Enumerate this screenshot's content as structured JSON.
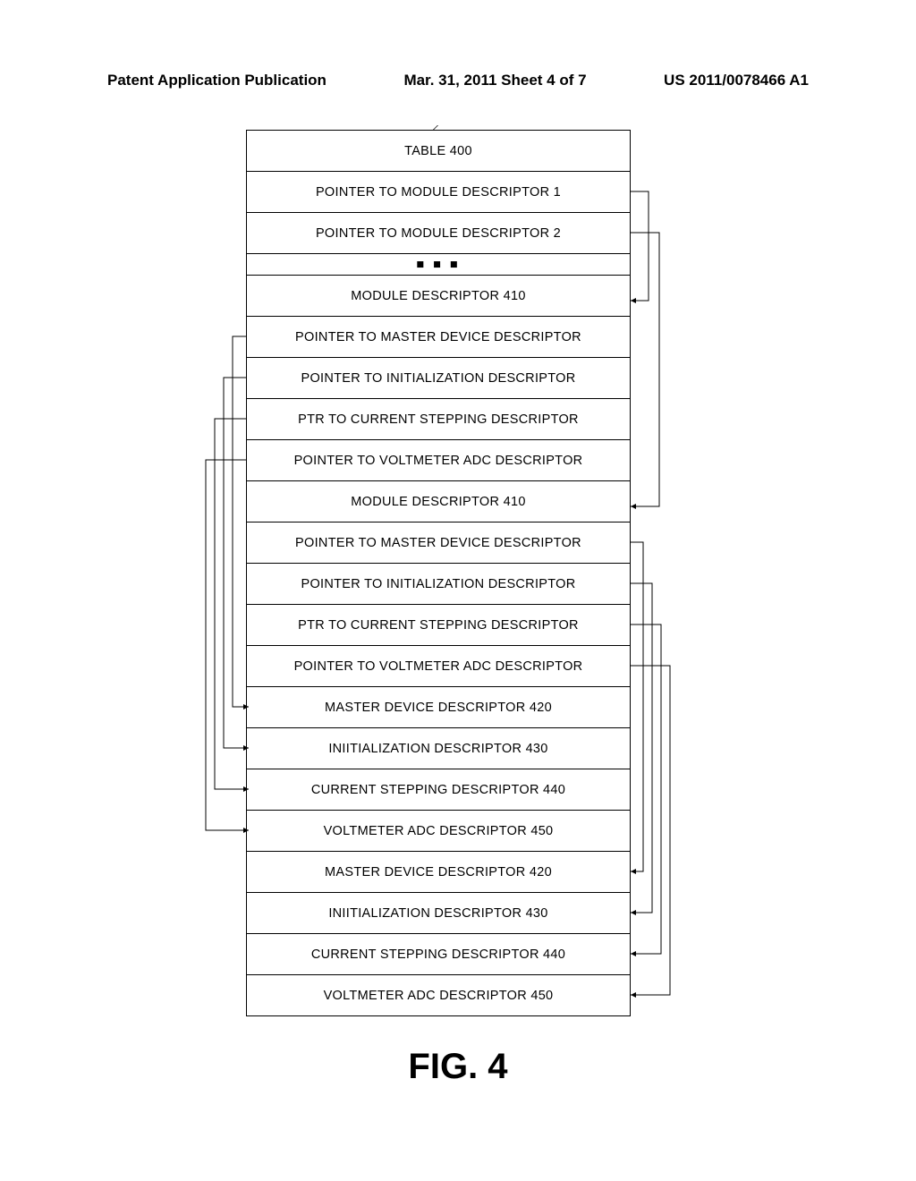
{
  "header": {
    "left": "Patent Application Publication",
    "mid": "Mar. 31, 2011  Sheet 4 of 7",
    "right": "US 2011/0078466 A1"
  },
  "table_title": "TABLE 400",
  "rows": [
    "POINTER TO MODULE DESCRIPTOR 1",
    "POINTER TO MODULE DESCRIPTOR 2",
    "■ ■ ■",
    "MODULE DESCRIPTOR 410",
    "POINTER TO MASTER DEVICE DESCRIPTOR",
    "POINTER TO INITIALIZATION DESCRIPTOR",
    "PTR TO CURRENT STEPPING  DESCRIPTOR",
    "POINTER TO VOLTMETER ADC DESCRIPTOR",
    "MODULE DESCRIPTOR 410",
    "POINTER TO MASTER DEVICE DESCRIPTOR",
    "POINTER TO INITIALIZATION DESCRIPTOR",
    "PTR TO CURRENT STEPPING  DESCRIPTOR",
    "POINTER TO VOLTMETER ADC DESCRIPTOR",
    "MASTER DEVICE DESCRIPTOR 420",
    "INIITIALIZATION DESCRIPTOR 430",
    "CURRENT STEPPING DESCRIPTOR 440",
    "VOLTMETER ADC DESCRIPTOR 450",
    "MASTER DEVICE DESCRIPTOR 420",
    "INIITIALIZATION DESCRIPTOR 430",
    "CURRENT STEPPING DESCRIPTOR 440",
    "VOLTMETER ADC DESCRIPTOR 450"
  ],
  "figure_label": "FIG. 4",
  "chart_data": {
    "type": "table",
    "title": "TABLE 400 — descriptor pointer table with connector arrows",
    "pointer_connections": [
      {
        "from": "POINTER TO MODULE DESCRIPTOR 1",
        "to": "MODULE DESCRIPTOR 410 (first)"
      },
      {
        "from": "POINTER TO MODULE DESCRIPTOR 2",
        "to": "MODULE DESCRIPTOR 410 (second)"
      },
      {
        "from": "Module1.POINTER TO MASTER DEVICE DESCRIPTOR",
        "to": "MASTER DEVICE DESCRIPTOR 420 (first)"
      },
      {
        "from": "Module1.POINTER TO INITIALIZATION DESCRIPTOR",
        "to": "INIITIALIZATION DESCRIPTOR 430 (first)"
      },
      {
        "from": "Module1.PTR TO CURRENT STEPPING DESCRIPTOR",
        "to": "CURRENT STEPPING DESCRIPTOR 440 (first)"
      },
      {
        "from": "Module1.POINTER TO VOLTMETER ADC DESCRIPTOR",
        "to": "VOLTMETER ADC DESCRIPTOR 450 (first)"
      },
      {
        "from": "Module2.POINTER TO MASTER DEVICE DESCRIPTOR",
        "to": "MASTER DEVICE DESCRIPTOR 420 (second)"
      },
      {
        "from": "Module2.POINTER TO INITIALIZATION DESCRIPTOR",
        "to": "INIITIALIZATION DESCRIPTOR 430 (second)"
      },
      {
        "from": "Module2.PTR TO CURRENT STEPPING DESCRIPTOR",
        "to": "CURRENT STEPPING DESCRIPTOR 440 (second)"
      },
      {
        "from": "Module2.POINTER TO VOLTMETER ADC DESCRIPTOR",
        "to": "VOLTMETER ADC DESCRIPTOR 450 (second)"
      }
    ]
  }
}
